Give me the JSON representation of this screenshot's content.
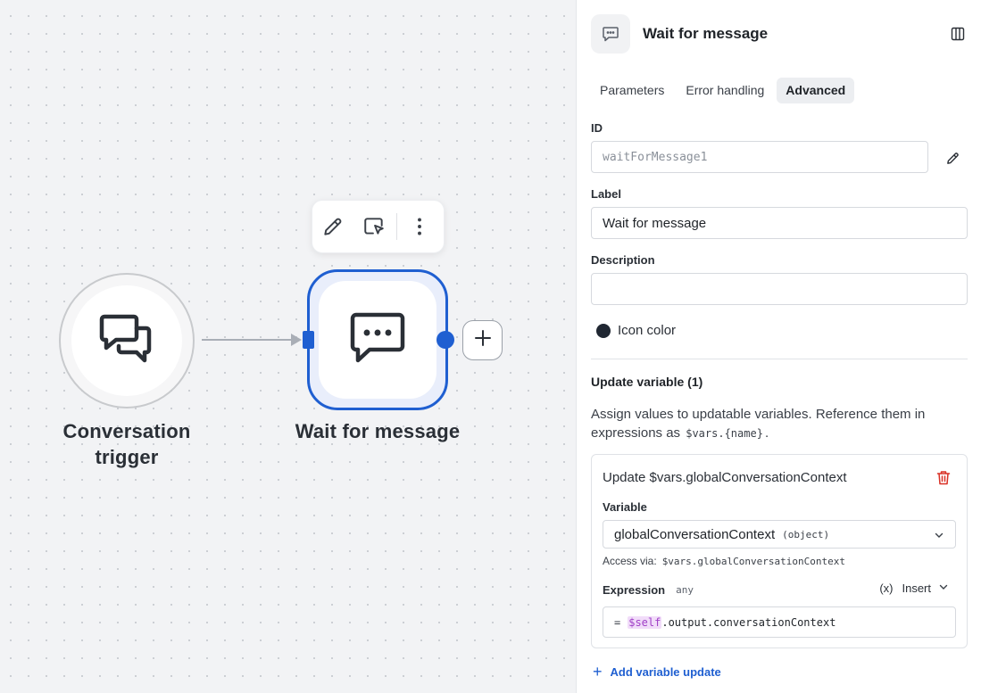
{
  "canvas": {
    "trigger_node": {
      "title_line1": "Conversation",
      "title_line2": "trigger",
      "icon": "chat-bubbles-icon"
    },
    "wait_node": {
      "title": "Wait for message",
      "icon": "message-dots-icon",
      "selected": true
    },
    "toolbar": {
      "icons": [
        "pencil-icon",
        "select-cursor-icon",
        "more-vertical-icon"
      ]
    },
    "add_node_icon": "plus-icon",
    "accent_color": "#1f5fd1"
  },
  "panel": {
    "title": "Wait for message",
    "header_icon": "message-dots-icon",
    "tabs": [
      {
        "label": "Parameters",
        "active": false
      },
      {
        "label": "Error handling",
        "active": false
      },
      {
        "label": "Advanced",
        "active": true
      }
    ],
    "id_field": {
      "label": "ID",
      "value": "waitForMessage1"
    },
    "label_field": {
      "label": "Label",
      "value": "Wait for message"
    },
    "description_field": {
      "label": "Description",
      "value": ""
    },
    "icon_color": {
      "label": "Icon color",
      "color": "#202732"
    },
    "update_variable": {
      "title": "Update variable (1)",
      "desc_text": "Assign values to updatable variables. Reference them in expressions as",
      "desc_code": "$vars.{name}",
      "desc_end": ".",
      "card": {
        "title": "Update $vars.globalConversationContext",
        "variable_label": "Variable",
        "variable_value": "globalConversationContext",
        "variable_type": "(object)",
        "access_label": "Access via:",
        "access_code": "$vars.globalConversationContext",
        "expression_label": "Expression",
        "expression_type": "any",
        "insert_label": "Insert",
        "insert_icon": "(x)",
        "expression_eq": "=",
        "expression_self": "$self",
        "expression_rest": ".output.conversationContext"
      },
      "add_label": "Add variable update"
    }
  }
}
